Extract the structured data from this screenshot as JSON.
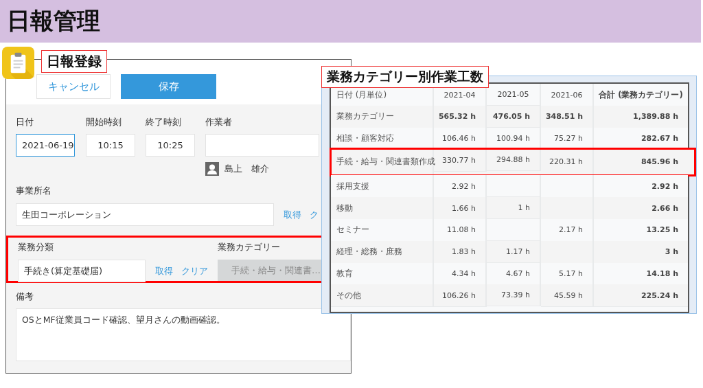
{
  "header": {
    "title": "日報管理"
  },
  "form": {
    "callout": "日報登録",
    "buttons": [
      {
        "label": "キャンセル",
        "kind": "secondary"
      },
      {
        "label": "保存",
        "kind": "primary"
      }
    ],
    "fields": [
      {
        "label": "日付",
        "value": "2021-06-19",
        "focused": true
      },
      {
        "label": "開始時刻",
        "value": "10:15",
        "focused": false
      },
      {
        "label": "終了時刻",
        "value": "10:25",
        "focused": false
      }
    ],
    "worker": {
      "label": "作業者",
      "name": "島上　雄介"
    },
    "office": {
      "label": "事業所名",
      "value": "生田コーポレーション",
      "links": [
        "取得",
        "ク"
      ]
    },
    "business": {
      "highlighted": true,
      "label": "業務分類",
      "value": "手続き(算定基礎届)",
      "links": [
        "取得",
        "クリア"
      ],
      "category_label": "業務カテゴリー",
      "category_value": "手続・給与・関連書…"
    },
    "notes": {
      "label": "備考",
      "value": "OSとMF従業員コード確認、望月さんの動画確認。"
    }
  },
  "table_panel": {
    "callout": "業務カテゴリー別作業工数",
    "columns": [
      "日付 (月単位)",
      "2021-04",
      "2021-05",
      "2021-06",
      "合計 (業務カテゴリー)"
    ],
    "rows": [
      {
        "kind": "total",
        "highlighted": false,
        "cells": [
          "業務カテゴリー",
          "565.32 h",
          "476.05 h",
          "348.51 h",
          "1,389.88 h"
        ]
      },
      {
        "kind": "item",
        "highlighted": false,
        "cells": [
          "相談・顧客対応",
          "106.46 h",
          "100.94 h",
          "75.27 h",
          "282.67 h"
        ]
      },
      {
        "kind": "item",
        "highlighted": true,
        "cells": [
          "手続・給与・関連書類作成",
          "330.77 h",
          "294.88 h",
          "220.31 h",
          "845.96 h"
        ]
      },
      {
        "kind": "item",
        "highlighted": false,
        "cells": [
          "採用支援",
          "2.92 h",
          null,
          null,
          "2.92 h"
        ]
      },
      {
        "kind": "item",
        "highlighted": false,
        "cells": [
          "移動",
          "1.66 h",
          "1 h",
          null,
          "2.66 h"
        ]
      },
      {
        "kind": "item",
        "highlighted": false,
        "cells": [
          "セミナー",
          "11.08 h",
          null,
          "2.17 h",
          "13.25 h"
        ]
      },
      {
        "kind": "item",
        "highlighted": false,
        "cells": [
          "経理・総務・庶務",
          "1.83 h",
          "1.17 h",
          null,
          "3 h"
        ]
      },
      {
        "kind": "item",
        "highlighted": false,
        "cells": [
          "教育",
          "4.34 h",
          "4.67 h",
          "5.17 h",
          "14.18 h"
        ]
      },
      {
        "kind": "item",
        "highlighted": false,
        "cells": [
          "その他",
          "106.26 h",
          "73.39 h",
          "45.59 h",
          "225.24 h"
        ]
      }
    ]
  }
}
